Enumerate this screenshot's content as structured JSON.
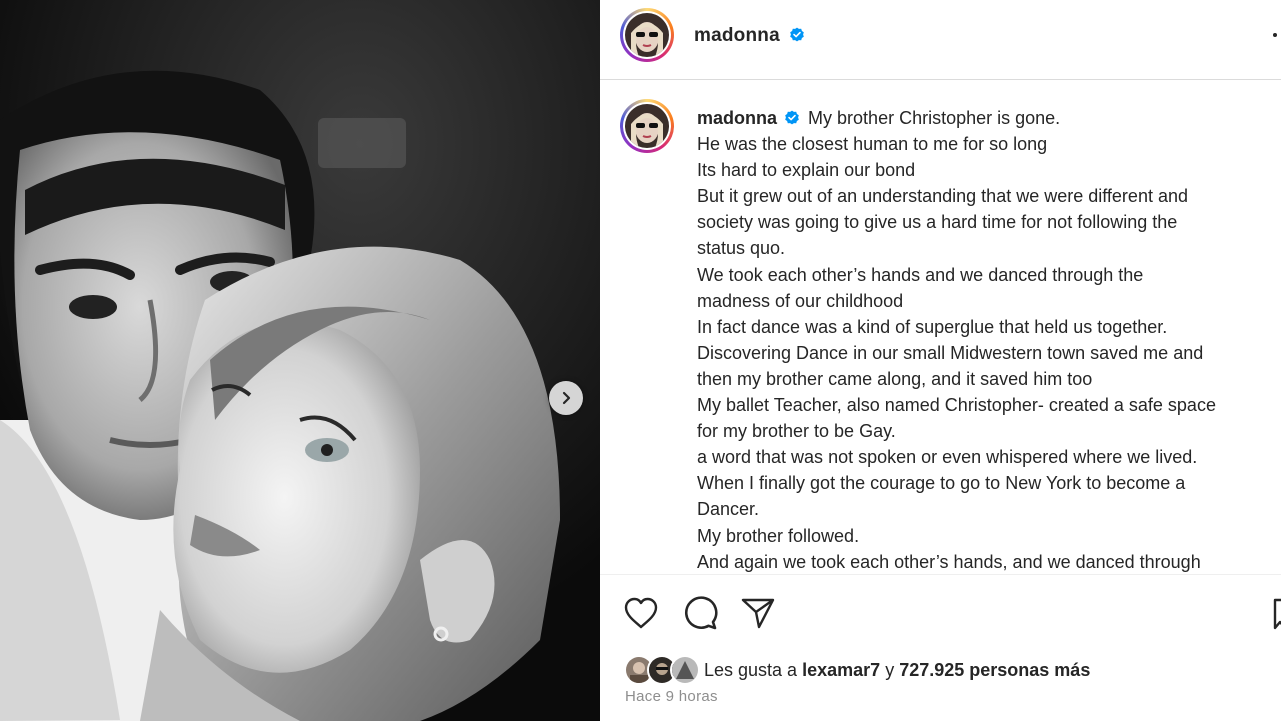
{
  "post": {
    "username": "madonna",
    "verified": true,
    "caption_lines": [
      "My brother Christopher is gone.",
      "He was the closest human to me for so long",
      "Its hard to explain our bond",
      "But it grew out of an understanding that we were different and",
      "society was going to give us a hard time for not following the",
      "status quo.",
      "We took each other’s hands and we danced through the",
      "madness of our childhood",
      "In fact dance was a kind of superglue that held us together.",
      "Discovering Dance in our small Midwestern town saved me and",
      "then my brother came along, and it saved him too",
      "My ballet Teacher, also named Christopher- created a safe space",
      "for my brother to be Gay.",
      "a word that was not spoken or even whispered where we lived.",
      "When I finally got the courage to go to New York to become a",
      "Dancer.",
      "My brother followed.",
      "And again we took each other’s hands, and we danced through"
    ],
    "likes": {
      "prefix": "Les gusta a",
      "user": "lexamar7",
      "conjunction": "y",
      "others": "727.925 personas más"
    },
    "timestamp": "Hace 9 horas"
  },
  "icons": {
    "verified": "verified-badge-icon",
    "like": "heart-icon",
    "comment": "comment-bubble-icon",
    "share": "paper-plane-icon",
    "save": "bookmark-icon",
    "next": "chevron-right-icon",
    "more": "more-options-icon"
  },
  "colors": {
    "verified_blue": "#0095f6",
    "text": "#262626",
    "secondary_text": "#8e8e8e",
    "divider": "#dbdbdb"
  }
}
